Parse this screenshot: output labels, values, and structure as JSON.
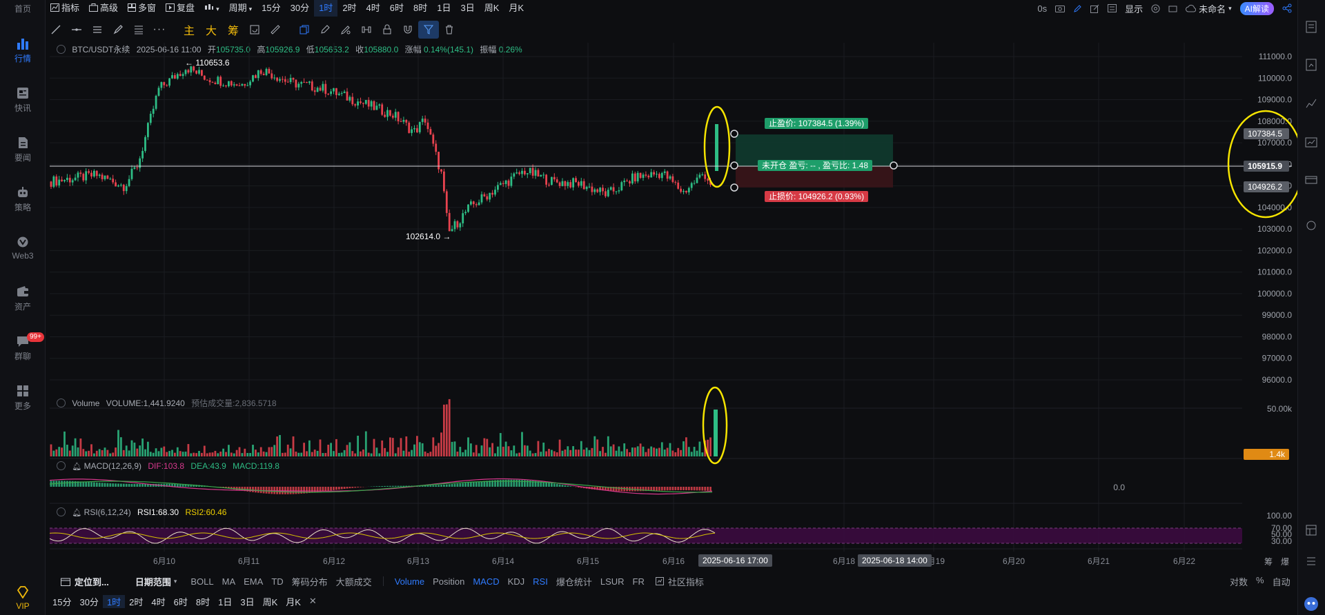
{
  "nav": {
    "items": [
      {
        "label": "首页",
        "active": false
      },
      {
        "label": "行情",
        "active": true
      },
      {
        "label": "快讯",
        "active": false
      },
      {
        "label": "要闻",
        "active": false
      },
      {
        "label": "策略",
        "active": false
      },
      {
        "label": "Web3",
        "active": false
      },
      {
        "label": "资产",
        "active": false
      },
      {
        "label": "群聊",
        "active": false,
        "badge": "99+"
      },
      {
        "label": "更多",
        "active": false
      }
    ],
    "vip": "VIP"
  },
  "toolbar": {
    "indicator": "指标",
    "advanced": "高级",
    "multi_window": "多窗",
    "replay": "复盘",
    "period": "周期",
    "periods": [
      "15分",
      "30分",
      "1时",
      "2时",
      "4时",
      "6时",
      "8时",
      "1日",
      "3日",
      "周K",
      "月K"
    ],
    "active_period": "1时",
    "countdown": "0s",
    "display": "显示",
    "layout_name": "未命名",
    "ai": "AI解读"
  },
  "drawbar": {
    "main": "主",
    "big": "大",
    "chips": "筹"
  },
  "ohlc": {
    "symbol": "BTC/USDT永续",
    "time": "2025-06-16 11:00",
    "open_label": "开",
    "open": "105735.0",
    "high_label": "高",
    "high": "105926.9",
    "low_label": "低",
    "low": "105653.2",
    "close_label": "收",
    "close": "105880.0",
    "change_label": "涨幅",
    "change": "0.14%(145.1)",
    "amp_label": "振幅",
    "amp": "0.26%"
  },
  "annotations": {
    "high": "← 110653.6",
    "low": "102614.0 →",
    "take_profit": "止盈价: 107384.5 (1.39%)",
    "stop_loss": "止损价: 104926.2 (0.93%)",
    "position": "未开仓 盈亏: -- , 盈亏比: 1.48",
    "tag_tp": "107384.5",
    "tag_last": "105915.9",
    "tag_sl": "104926.2",
    "tag_vol": "1.4k"
  },
  "price_axis": [
    "111000.0",
    "110000.0",
    "109000.0",
    "108000.0",
    "107000.0",
    "106000.0",
    "105000.0",
    "104000.0",
    "103000.0",
    "102000.0",
    "101000.0",
    "100000.0",
    "99000.0",
    "98000.0",
    "97000.0",
    "96000.0"
  ],
  "volume_axis": "50.00k",
  "macd_axis": "0.0",
  "rsi_axis": [
    "100.00",
    "70.00",
    "50.00",
    "30.00"
  ],
  "legends": {
    "volume": {
      "name": "Volume",
      "value": "VOLUME:1,441.9240",
      "est": "预估成交量:2,836.5718"
    },
    "macd": {
      "name": "MACD(12,26,9)",
      "dif": "DIF:103.8",
      "dea": "DEA:43.9",
      "macd": "MACD:119.8"
    },
    "rsi": {
      "name": "RSI(6,12,24)",
      "rsi1": "RSI1:68.30",
      "rsi2": "RSI2:60.46"
    }
  },
  "x_axis": {
    "labels": [
      "6月10",
      "6月11",
      "6月12",
      "6月13",
      "6月14",
      "6月15",
      "6月16",
      "6月18",
      "6月19",
      "6月20",
      "6月21",
      "6月22"
    ],
    "cursor1": "2025-06-16 17:00",
    "cursor2": "2025-06-18 14:00",
    "right": [
      "筹",
      "爆"
    ]
  },
  "bottom": {
    "locate": "定位到...",
    "range": "日期范围",
    "indicators": [
      "BOLL",
      "MA",
      "EMA",
      "TD",
      "筹码分布",
      "大额成交"
    ],
    "sub_indicators": [
      {
        "label": "Volume",
        "active": true
      },
      {
        "label": "Position",
        "active": false
      },
      {
        "label": "MACD",
        "active": true
      },
      {
        "label": "KDJ",
        "active": false
      },
      {
        "label": "RSI",
        "active": true
      },
      {
        "label": "爆仓统计",
        "active": false
      },
      {
        "label": "LSUR",
        "active": false
      },
      {
        "label": "FR",
        "active": false
      }
    ],
    "community": "社区指标",
    "right": [
      "对数",
      "%",
      "自动"
    ],
    "periods": [
      "15分",
      "30分",
      "1时",
      "2时",
      "4时",
      "6时",
      "8时",
      "1日",
      "3日",
      "周K",
      "月K"
    ],
    "active_period": "1时"
  },
  "colors": {
    "up": "#2ebd85",
    "down": "#e8434f",
    "accent": "#2f7bff",
    "highlight": "#f5e400",
    "macd_dif": "#d9398e",
    "rsi_band": "#3b0b3f"
  }
}
